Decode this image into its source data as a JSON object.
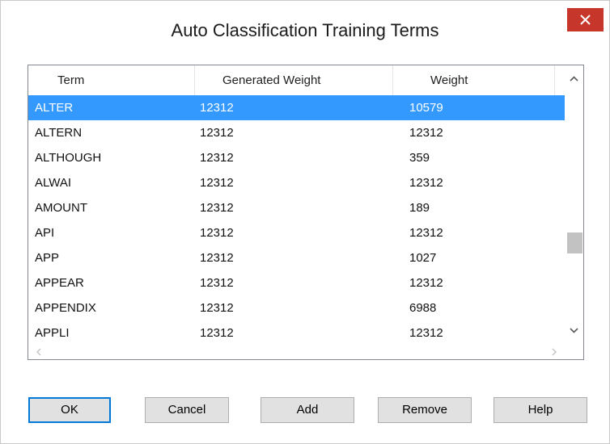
{
  "dialog": {
    "title": "Auto Classification Training Terms"
  },
  "table": {
    "columns": [
      "Term",
      "Generated Weight",
      "Weight"
    ],
    "rows": [
      {
        "term": "ALTER",
        "generated": "12312",
        "weight": "10579",
        "selected": true
      },
      {
        "term": "ALTERN",
        "generated": "12312",
        "weight": "12312"
      },
      {
        "term": "ALTHOUGH",
        "generated": "12312",
        "weight": "359"
      },
      {
        "term": "ALWAI",
        "generated": "12312",
        "weight": "12312"
      },
      {
        "term": "AMOUNT",
        "generated": "12312",
        "weight": "189"
      },
      {
        "term": "API",
        "generated": "12312",
        "weight": "12312"
      },
      {
        "term": "APP",
        "generated": "12312",
        "weight": "1027"
      },
      {
        "term": "APPEAR",
        "generated": "12312",
        "weight": "12312"
      },
      {
        "term": "APPENDIX",
        "generated": "12312",
        "weight": "6988"
      },
      {
        "term": "APPLI",
        "generated": "12312",
        "weight": "12312"
      }
    ]
  },
  "buttons": {
    "ok": "OK",
    "cancel": "Cancel",
    "add": "Add",
    "remove": "Remove",
    "help": "Help"
  },
  "colors": {
    "selection": "#3399ff",
    "close_button": "#c7362a",
    "default_button_border": "#0078d7"
  }
}
